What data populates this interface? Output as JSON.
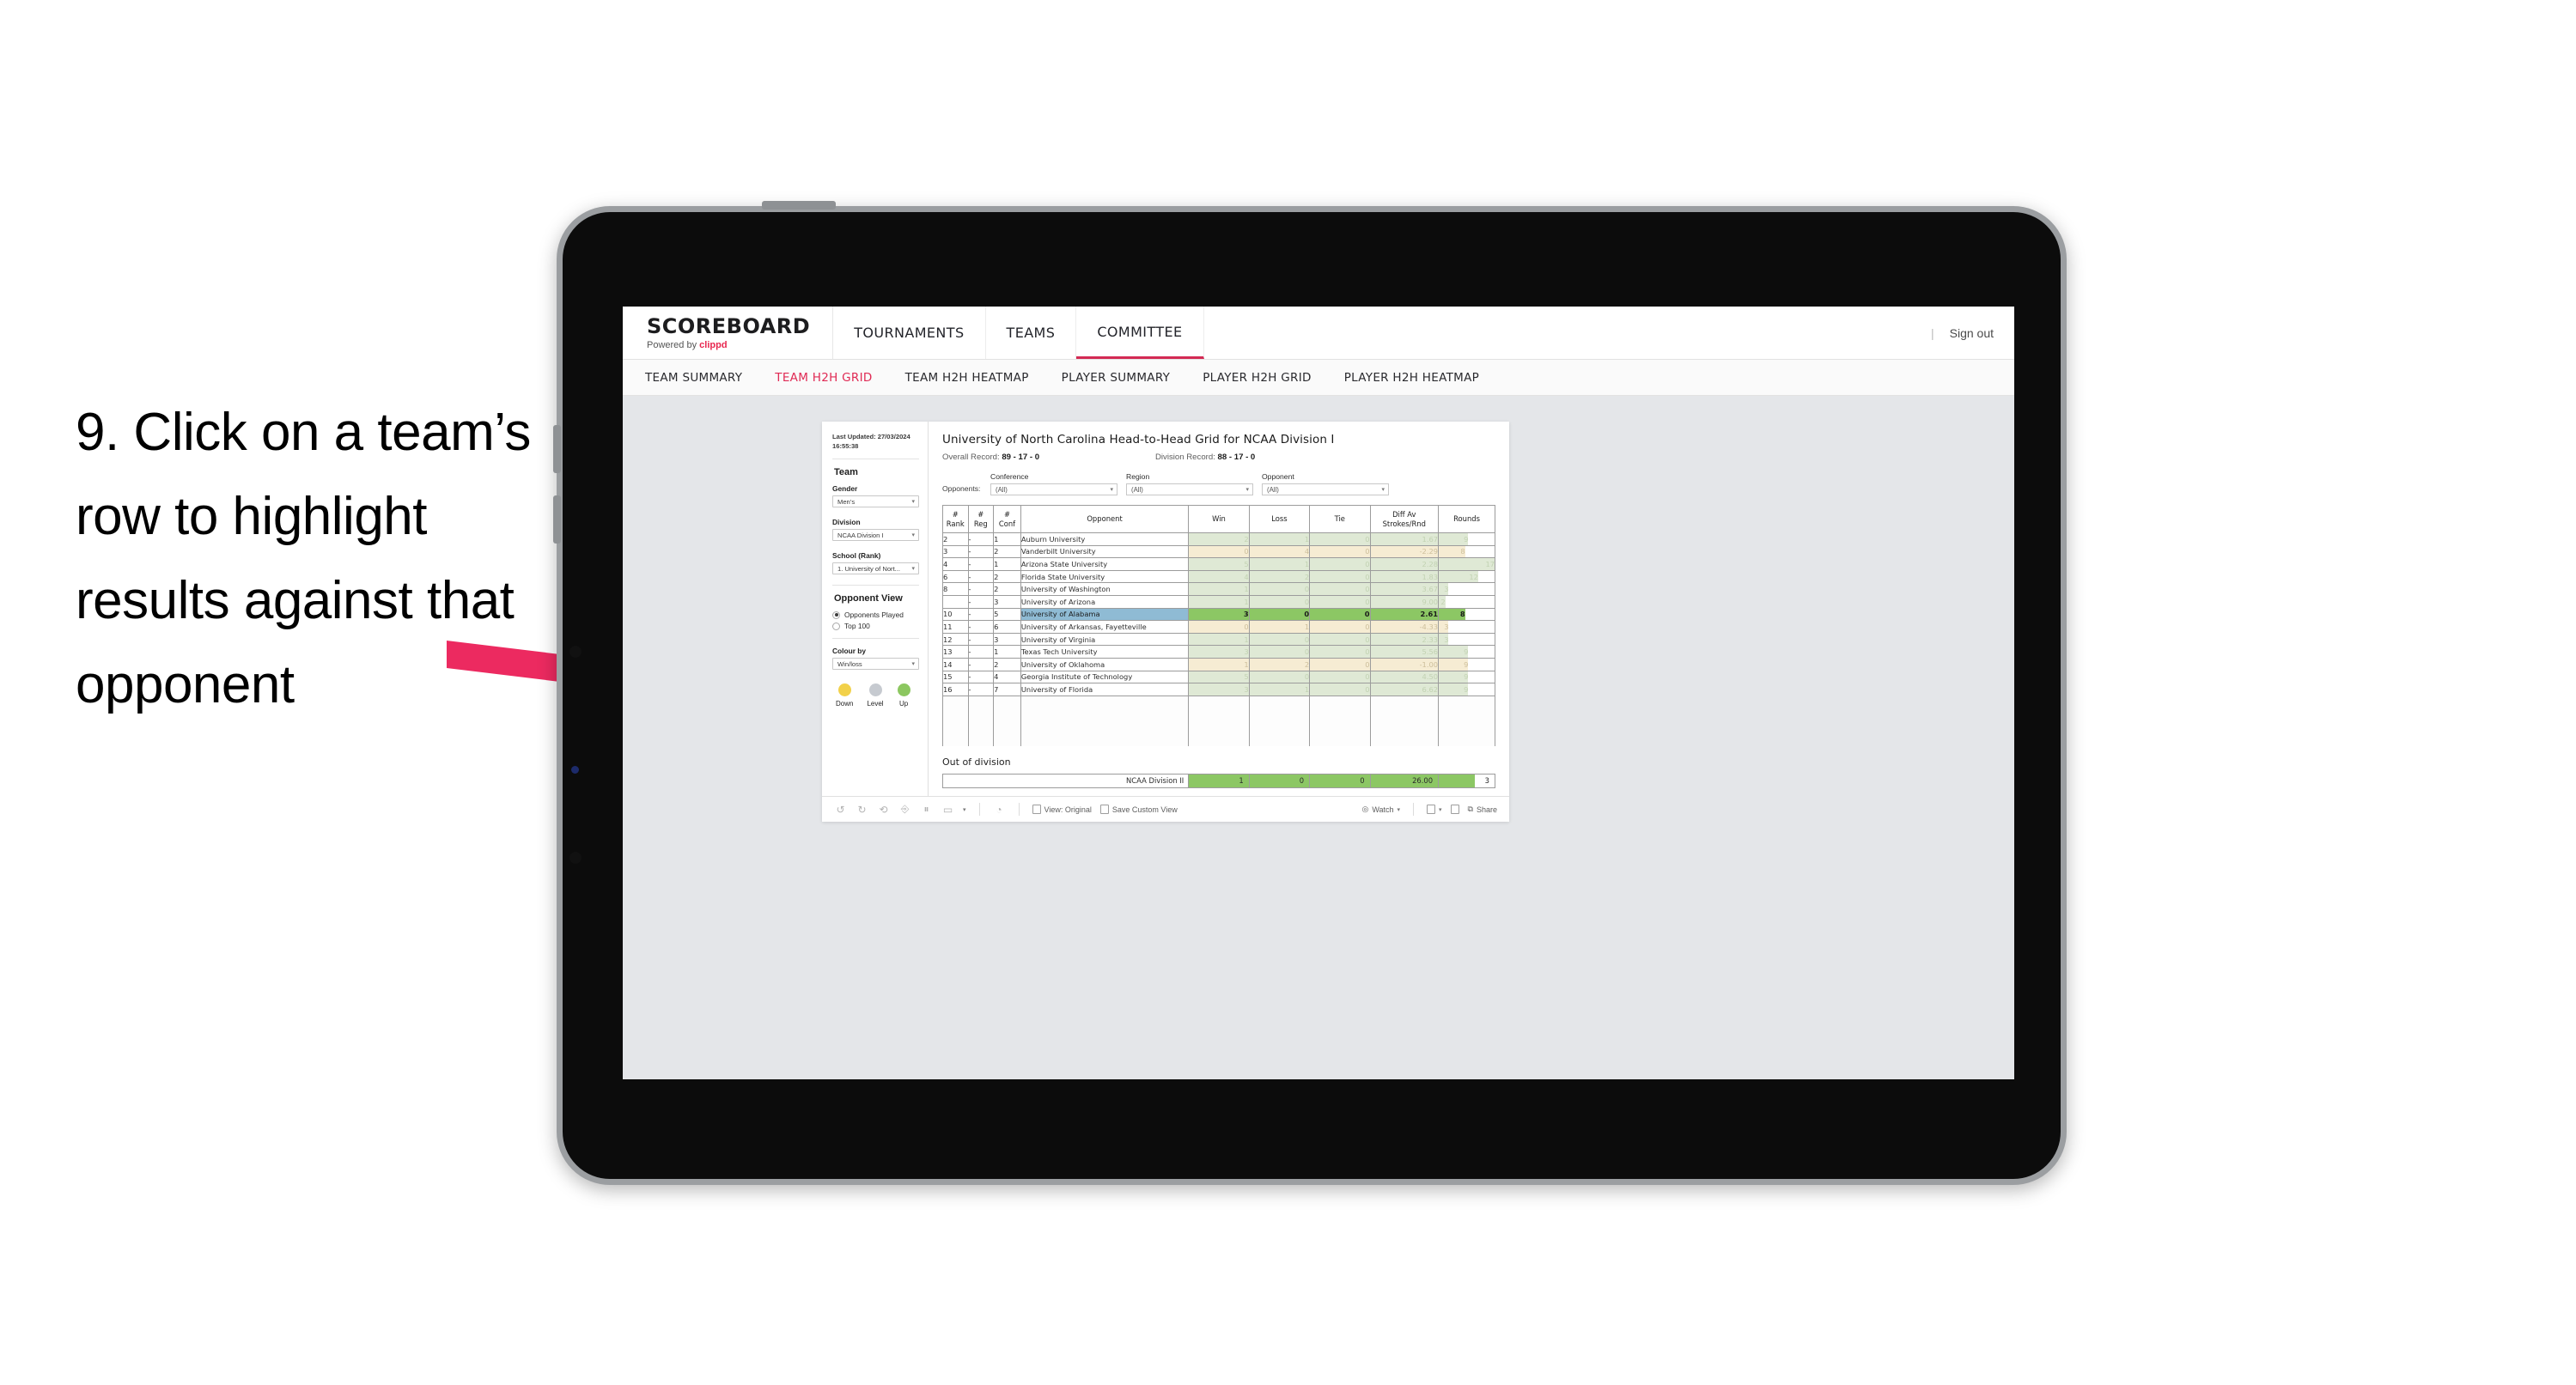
{
  "annotation": {
    "text": "9. Click on a team’s row to highlight results against that opponent",
    "arrow_color": "#ec2a60"
  },
  "browser": {
    "brand": {
      "name": "SCOREBOARD",
      "powered_prefix": "Powered by ",
      "powered_brand": "clippd"
    },
    "nav": [
      {
        "label": "TOURNAMENTS",
        "active": false
      },
      {
        "label": "TEAMS",
        "active": false
      },
      {
        "label": "COMMITTEE",
        "active": true
      }
    ],
    "sign_out": "Sign out",
    "subnav": [
      {
        "label": "TEAM SUMMARY",
        "active": false
      },
      {
        "label": "TEAM H2H GRID",
        "active": true
      },
      {
        "label": "TEAM H2H HEATMAP",
        "active": false
      },
      {
        "label": "PLAYER SUMMARY",
        "active": false
      },
      {
        "label": "PLAYER H2H GRID",
        "active": false
      },
      {
        "label": "PLAYER H2H HEATMAP",
        "active": false
      }
    ]
  },
  "sidebar": {
    "last_updated_label": "Last Updated: 27/03/2024",
    "last_updated_time": "16:55:38",
    "team_heading": "Team",
    "gender_label": "Gender",
    "gender_value": "Men’s",
    "division_label": "Division",
    "division_value": "NCAA Division I",
    "school_label": "School (Rank)",
    "school_value": "1. University of Nort...",
    "opponent_view_heading": "Opponent View",
    "opponent_view_options": [
      {
        "label": "Opponents Played",
        "selected": true
      },
      {
        "label": "Top 100",
        "selected": false
      }
    ],
    "colour_by_label": "Colour by",
    "colour_by_value": "Win/loss",
    "legend": [
      {
        "caption": "Down",
        "color": "#f2d14a"
      },
      {
        "caption": "Level",
        "color": "#c6cad0"
      },
      {
        "caption": "Up",
        "color": "#8cc760"
      }
    ]
  },
  "main": {
    "title": "University of North Carolina Head-to-Head Grid for NCAA Division I",
    "overall_record_label": "Overall Record:",
    "overall_record_value": "89 - 17 - 0",
    "division_record_label": "Division Record:",
    "division_record_value": "88 - 17 - 0",
    "opponents_label": "Opponents:",
    "filters": [
      {
        "caption": "Conference",
        "value": "(All)"
      },
      {
        "caption": "Region",
        "value": "(All)"
      },
      {
        "caption": "Opponent",
        "value": "(All)"
      }
    ],
    "out_of_division_title": "Out of division",
    "out_of_division_row": {
      "label": "NCAA Division II",
      "win": "1",
      "loss": "0",
      "tie": "0",
      "diff": "26.00",
      "rounds": "3"
    }
  },
  "chart_data": {
    "type": "table",
    "title": "University of North Carolina Head-to-Head Grid for NCAA Division I",
    "columns": [
      "# Rank",
      "# Reg",
      "# Conf",
      "Opponent",
      "Win",
      "Loss",
      "Tie",
      "Diff Av Strokes/Rnd",
      "Rounds"
    ],
    "rows": [
      {
        "rank": "2",
        "reg": "-",
        "conf": "1",
        "opponent": "Auburn University",
        "win": "2",
        "loss": "1",
        "tie": "0",
        "diff": "1.67",
        "rounds": "9",
        "tone": "up",
        "selected": false
      },
      {
        "rank": "3",
        "reg": "-",
        "conf": "2",
        "opponent": "Vanderbilt University",
        "win": "0",
        "loss": "4",
        "tie": "0",
        "diff": "-2.29",
        "rounds": "8",
        "tone": "down",
        "selected": false
      },
      {
        "rank": "4",
        "reg": "-",
        "conf": "1",
        "opponent": "Arizona State University",
        "win": "5",
        "loss": "1",
        "tie": "0",
        "diff": "2.28",
        "rounds": "17",
        "tone": "up",
        "selected": false
      },
      {
        "rank": "6",
        "reg": "-",
        "conf": "2",
        "opponent": "Florida State University",
        "win": "4",
        "loss": "2",
        "tie": "0",
        "diff": "1.83",
        "rounds": "12",
        "tone": "up",
        "selected": false
      },
      {
        "rank": "8",
        "reg": "-",
        "conf": "2",
        "opponent": "University of Washington",
        "win": "1",
        "loss": "0",
        "tie": "0",
        "diff": "3.67",
        "rounds": "3",
        "tone": "up",
        "selected": false
      },
      {
        "rank": "",
        "reg": "-",
        "conf": "3",
        "opponent": "University of Arizona",
        "win": "1",
        "loss": "0",
        "tie": "0",
        "diff": "9.00",
        "rounds": "2",
        "tone": "up",
        "selected": false
      },
      {
        "rank": "10",
        "reg": "-",
        "conf": "5",
        "opponent": "University of Alabama",
        "win": "3",
        "loss": "0",
        "tie": "0",
        "diff": "2.61",
        "rounds": "8",
        "tone": "up",
        "selected": true
      },
      {
        "rank": "11",
        "reg": "-",
        "conf": "6",
        "opponent": "University of Arkansas, Fayetteville",
        "win": "0",
        "loss": "1",
        "tie": "0",
        "diff": "-4.33",
        "rounds": "3",
        "tone": "down",
        "selected": false
      },
      {
        "rank": "12",
        "reg": "-",
        "conf": "3",
        "opponent": "University of Virginia",
        "win": "1",
        "loss": "0",
        "tie": "0",
        "diff": "2.33",
        "rounds": "3",
        "tone": "up",
        "selected": false
      },
      {
        "rank": "13",
        "reg": "-",
        "conf": "1",
        "opponent": "Texas Tech University",
        "win": "3",
        "loss": "0",
        "tie": "0",
        "diff": "5.56",
        "rounds": "9",
        "tone": "up",
        "selected": false
      },
      {
        "rank": "14",
        "reg": "-",
        "conf": "2",
        "opponent": "University of Oklahoma",
        "win": "1",
        "loss": "2",
        "tie": "0",
        "diff": "-1.00",
        "rounds": "9",
        "tone": "down",
        "selected": false
      },
      {
        "rank": "15",
        "reg": "-",
        "conf": "4",
        "opponent": "Georgia Institute of Technology",
        "win": "5",
        "loss": "0",
        "tie": "0",
        "diff": "4.50",
        "rounds": "9",
        "tone": "up",
        "selected": false
      },
      {
        "rank": "16",
        "reg": "-",
        "conf": "7",
        "opponent": "University of Florida",
        "win": "3",
        "loss": "1",
        "tie": "0",
        "diff": "6.62",
        "rounds": "9",
        "tone": "up",
        "selected": false
      }
    ],
    "colors": {
      "up": "#dfe9d5",
      "down": "#f6ecd3",
      "selected_cell": "#8cc764",
      "selected_row": "#8fbbd4",
      "rounds_bar": "#e4eada"
    },
    "rounds_max": 17
  },
  "toolbar": {
    "view_original": "View: Original",
    "save_custom_view": "Save Custom View",
    "watch": "Watch",
    "share": "Share"
  }
}
